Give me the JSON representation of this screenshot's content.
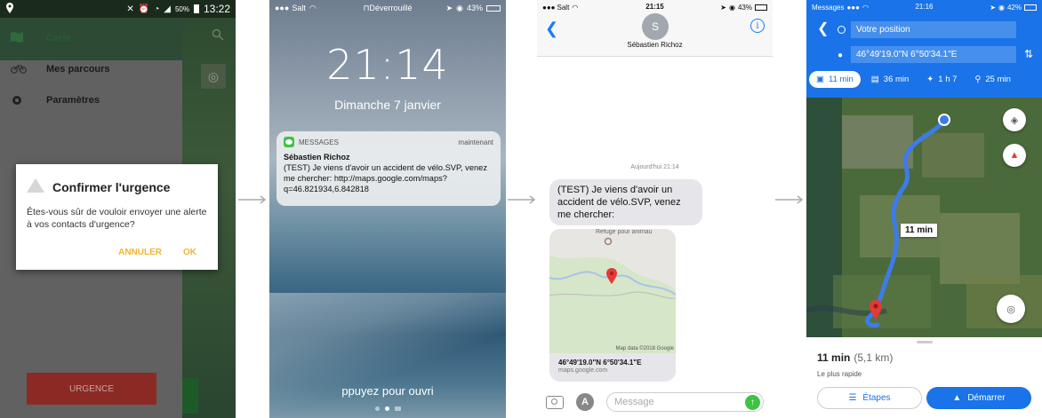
{
  "android": {
    "status_time": "13:22",
    "battery": "50%",
    "menu": [
      {
        "label": "Carte",
        "icon": "map-icon"
      },
      {
        "label": "Mes parcours",
        "icon": "bicycle-icon"
      },
      {
        "label": "Paramètres",
        "icon": "gear-icon"
      }
    ],
    "dialog": {
      "title": "Confirmer l'urgence",
      "body": "Êtes-vous sûr de vouloir envoyer une alerte à vos contacts d'urgence?",
      "cancel": "ANNULER",
      "ok": "OK"
    },
    "urgence_button": "URGENCE"
  },
  "lockscreen": {
    "carrier": "Salt",
    "lock_status": "Déverrouillé",
    "battery": "43%",
    "time": "21:14",
    "date": "Dimanche 7 janvier",
    "notification": {
      "app": "MESSAGES",
      "when": "maintenant",
      "sender": "Sébastien Richoz",
      "message": "(TEST) Je viens d'avoir un accident de vélo.SVP, venez me chercher: http://maps.google.com/maps?q=46.821934,6.842818"
    },
    "unlock_hint": "ppuyez pour ouvri"
  },
  "imessage": {
    "carrier": "Salt",
    "time": "21:15",
    "battery": "43%",
    "avatar_initial": "S",
    "contact_name": "Sébastien Richoz",
    "timestamp": "Aujourd'hui 21:14",
    "bubble_text": "(TEST) Je viens d'avoir un accident de vélo.SVP, venez me chercher:",
    "map_poi": "Refuge pour animau",
    "map_attribution": "Map data ©2018 Google",
    "coordinates": "46°49'19.0\"N 6°50'34.1\"E",
    "source": "maps.google.com",
    "input_placeholder": "Message"
  },
  "gmaps": {
    "status_left": "Messages",
    "time": "21:16",
    "battery": "42%",
    "origin": "Votre position",
    "destination": "46°49'19.0\"N 6°50'34.1\"E",
    "modes": [
      {
        "label": "11 min",
        "icon": "car-icon",
        "selected": true
      },
      {
        "label": "36 min",
        "icon": "transit-icon",
        "selected": false
      },
      {
        "label": "1 h 7",
        "icon": "walk-icon",
        "selected": false
      },
      {
        "label": "25 min",
        "icon": "bike-icon",
        "selected": false
      }
    ],
    "route_label": "11 min",
    "eta_time": "11 min",
    "eta_distance": "(5,1 km)",
    "route_note": "Le plus rapide",
    "steps_button": "Étapes",
    "start_button": "Démarrer",
    "colors": {
      "blue": "#1a73e8",
      "route": "#4a90e2",
      "pin": "#e53935"
    }
  }
}
